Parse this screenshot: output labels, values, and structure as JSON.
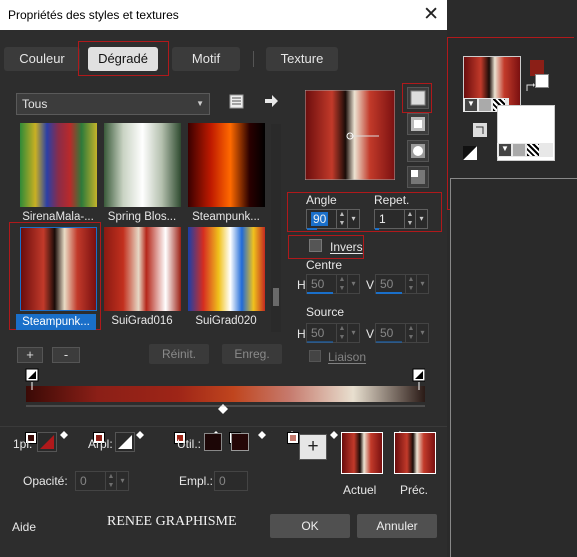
{
  "window": {
    "title": "Propriétés des styles et textures",
    "close": "✕"
  },
  "tabs": [
    {
      "label": "Couleur"
    },
    {
      "label": "Dégradé",
      "active": true
    },
    {
      "label": "Motif"
    },
    {
      "label": "Texture"
    }
  ],
  "category": {
    "selected": "Tous"
  },
  "gradients": [
    {
      "label": "SirenaMala-..."
    },
    {
      "label": "Spring Blos..."
    },
    {
      "label": "Steampunk..."
    },
    {
      "label": "Steampunk...",
      "selected": true
    },
    {
      "label": "SuiGrad016"
    },
    {
      "label": "SuiGrad020"
    }
  ],
  "buttons": {
    "add": "+",
    "remove": "-",
    "reset": "Réinit.",
    "save": "Enreg."
  },
  "angle": {
    "label": "Angle",
    "value": "90"
  },
  "repeat": {
    "label": "Repet.",
    "value": "1"
  },
  "invert": {
    "label": "Invers"
  },
  "center": {
    "label": "Centre",
    "h_label": "H",
    "h_value": "50",
    "v_label": "V",
    "v_value": "50"
  },
  "source": {
    "label": "Source",
    "h_label": "H",
    "h_value": "50",
    "v_label": "V",
    "v_value": "50",
    "link_label": "Liaison"
  },
  "bottom": {
    "pl_label": "1pl:",
    "arpl_label": "Arpl:",
    "util_label": "Util.:",
    "opacity_label": "Opacité:",
    "opacity_value": "0",
    "empl_label": "Empl.:",
    "empl_value": "0",
    "plus": "+",
    "current_label": "Actuel",
    "prev_label": "Préc."
  },
  "footer": {
    "help": "Aide",
    "watermark": "RENEE GRAPHISME",
    "ok": "OK",
    "cancel": "Annuler"
  },
  "colors": {
    "accent_red": "#b0191b",
    "selection_blue": "#1a6fc9",
    "dark_red": "#8b1f17"
  }
}
